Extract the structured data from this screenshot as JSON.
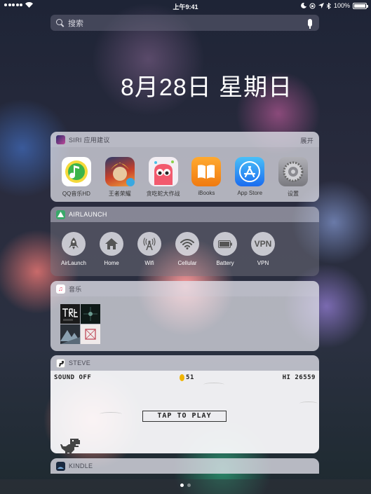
{
  "status_bar": {
    "time": "上午9:41",
    "battery": "100%",
    "battery_level": 1.0
  },
  "search": {
    "placeholder": "搜索"
  },
  "date": "8月28日 星期日",
  "siri": {
    "title": "SIRI 应用建议",
    "action": "展开",
    "apps": [
      {
        "label": "QQ音乐HD",
        "icon": "qq-music-icon",
        "color": "#f5d93a"
      },
      {
        "label": "王者荣耀",
        "icon": "honor-of-kings-icon",
        "color": "#c8402a"
      },
      {
        "label": "贪吃蛇大作战",
        "icon": "snake-io-icon",
        "color": "#f0e6f0"
      },
      {
        "label": "iBooks",
        "icon": "ibooks-icon",
        "color": "#f59a1e"
      },
      {
        "label": "App Store",
        "icon": "app-store-icon",
        "color": "#1a8cf0"
      },
      {
        "label": "设置",
        "icon": "settings-icon",
        "color": "#8e8e93"
      }
    ]
  },
  "airlaunch": {
    "title": "AIRLAUNCH",
    "items": [
      {
        "label": "AirLaunch",
        "icon": "rocket-icon"
      },
      {
        "label": "Home",
        "icon": "home-icon"
      },
      {
        "label": "Wifi",
        "icon": "antenna-icon"
      },
      {
        "label": "Cellular",
        "icon": "wifi-signal-icon"
      },
      {
        "label": "Battery",
        "icon": "battery-icon"
      },
      {
        "label": "VPN",
        "icon": "vpn-icon"
      }
    ]
  },
  "music": {
    "title": "音乐"
  },
  "steve": {
    "title": "STEVE",
    "sound": "SOUND OFF",
    "coins": "51",
    "hi": "HI 26559",
    "tap": "TAP TO PLAY"
  },
  "kindle": {
    "title": "KINDLE"
  }
}
